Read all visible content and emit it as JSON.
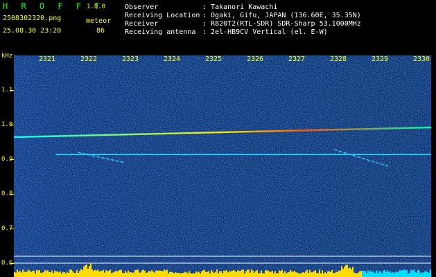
{
  "header": {
    "app_name": "H R O F F T",
    "version": "1.0.0",
    "filename": "2508302320.png",
    "datetime": "25.08.30 23:20",
    "meteor_label": "meteor",
    "meteor_count": "86",
    "observer_label": "Observer",
    "observer_value": ": Takanori Kawachi",
    "location_label": "Receiving Location",
    "location_value": ": Ogaki, Gifu, JAPAN (136.60E, 35.35N)",
    "receiver_label": "Receiver",
    "receiver_value": ": R820T2(RTL-SDR) SDR-Sharp 53.1000MHz",
    "antenna_label": "Receiving antenna",
    "antenna_value": ": 2el-HB9CV Vertical (el. E-W)"
  },
  "axis": {
    "y_unit": "kHz",
    "y_ticks": [
      "1.1",
      "1.0",
      "0.9",
      "0.8",
      "0.7",
      "0.6"
    ],
    "x_ticks": [
      "2321",
      "2322",
      "2323",
      "2324",
      "2325",
      "2326",
      "2327",
      "2328",
      "2329",
      "2330"
    ]
  },
  "colors": {
    "background": "#000000",
    "label": "#ffff00",
    "title": "#00ff00",
    "noise": "#0a1a7a",
    "trace": "#00ffdd"
  }
}
